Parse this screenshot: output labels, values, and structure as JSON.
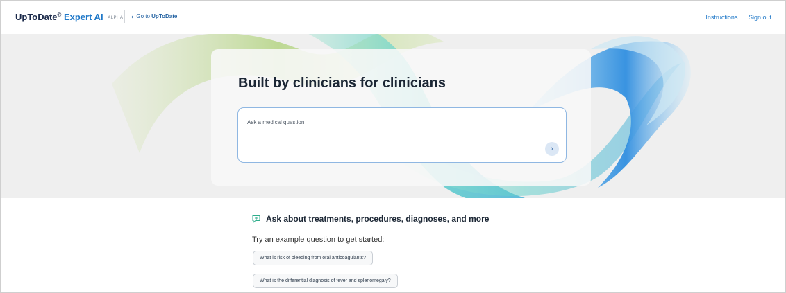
{
  "header": {
    "brand_main": "UpToDate",
    "brand_reg": "®",
    "brand_ai": "Expert AI",
    "brand_badge": "ALPHA",
    "back_prefix": "Go to",
    "back_target": "UpToDate",
    "links": [
      "Instructions",
      "Sign out"
    ]
  },
  "hero": {
    "title": "Built by clinicians for clinicians",
    "search_placeholder": "Ask a medical question"
  },
  "examples": {
    "heading": "Ask about treatments, procedures, diagnoses, and more",
    "intro": "Try an example question to get started:",
    "questions": [
      "What is risk of bleeding from oral anticoagulants?",
      "What is the differential diagnosis of fever and splenomegaly?"
    ]
  },
  "icons": {
    "back": "chevron-left-icon",
    "send": "chevron-right-icon",
    "examples": "chat-plus-icon"
  },
  "colors": {
    "brand_navy": "#1b2a4a",
    "accent_blue": "#1f78c8",
    "hero_background": "#efefef"
  }
}
